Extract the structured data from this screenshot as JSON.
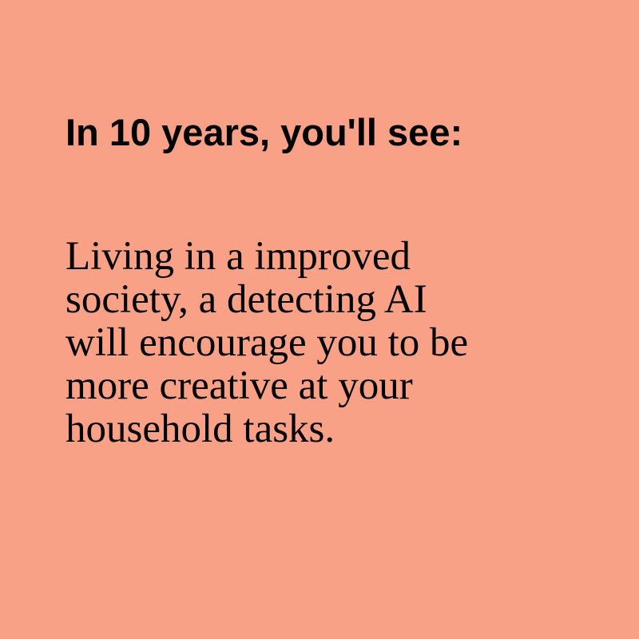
{
  "colors": {
    "background": "#F8A186",
    "text": "#000000"
  },
  "heading": "In 10 years, you'll see:",
  "body_lines": [
    "Living in a improved",
    "society, a detecting AI",
    "will encourage you to be",
    "more creative at your",
    "household tasks."
  ]
}
